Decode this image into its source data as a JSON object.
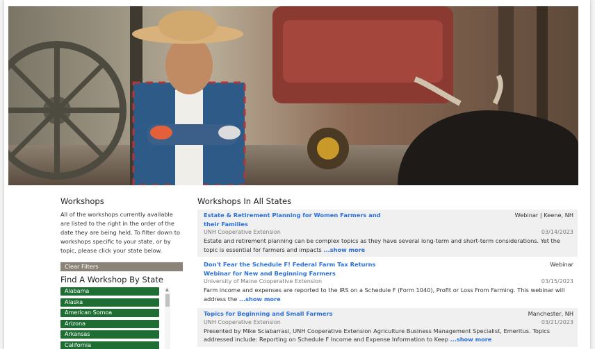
{
  "sidebar": {
    "title": "Workshops",
    "description": "All of the workshops currently available are listed to the right in the order of the date they are being held. To filter down to workshops specific to your state, or by topic, please click your state below.",
    "clear_filters": "Clear Filters",
    "find_title": "Find A Workshop By State",
    "states": [
      "Alabama",
      "Alaska",
      "American Somoa",
      "Arizona",
      "Arkansas",
      "California"
    ]
  },
  "main": {
    "title": "Workshops In All States",
    "workshops": [
      {
        "title": "Estate & Retirement Planning for Women Farmers and their Families",
        "location": "Webinar | Keene, NH",
        "org": "UNH Cooperative Extension",
        "date": "03/14/2023",
        "desc": "Estate and retirement planning can be complex topics as they have several long-term and short-term considerations. Yet the topic is essential for farmers and impacts ",
        "more": "...show more"
      },
      {
        "title": "Don't Fear the Schedule F! Federal Farm Tax Returns Webinar for New and Beginning Farmers",
        "location": "Webinar",
        "org": "University of Maine Cooperative Extension",
        "date": "03/15/2023",
        "desc": "Farm income and expenses are reported to the IRS on a Schedule F (Form 1040), Profit or Loss From Farming. This webinar will address the ",
        "more": "...show more"
      },
      {
        "title": "Topics for Beginning and Small Farmers",
        "location": "Manchester, NH",
        "org": "UNH Cooperative Extension",
        "date": "03/21/2023",
        "desc": "Presented by Mike Sciabarrasi, UNH Cooperative Extension Agriculture Business Management Specialist, Emeritus. Topics addressed include: Reporting on Schedule F Income and Expense Information to Keep ",
        "more": "...show more"
      }
    ]
  },
  "colors": {
    "state_button": "#1e6e34",
    "link": "#2a6fdb",
    "clear_button": "#8a8378"
  }
}
